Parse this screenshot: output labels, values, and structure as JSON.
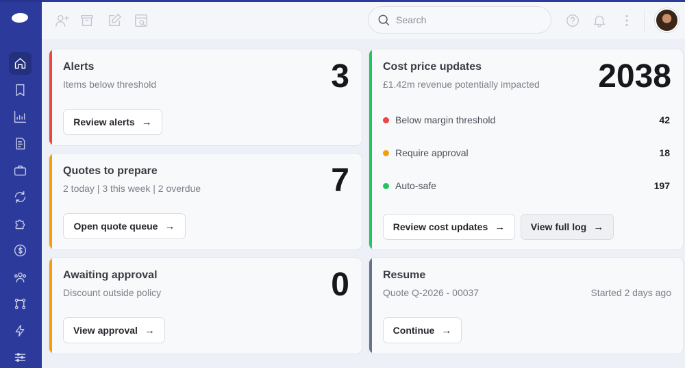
{
  "header": {
    "search_placeholder": "Search"
  },
  "sidebar": {
    "items": [
      {
        "name": "home-icon",
        "active": true
      },
      {
        "name": "bookmark-icon"
      },
      {
        "name": "chart-icon"
      },
      {
        "name": "invoice-icon"
      },
      {
        "name": "briefcase-icon"
      },
      {
        "name": "sync-icon"
      },
      {
        "name": "puzzle-icon"
      },
      {
        "name": "dollar-icon"
      },
      {
        "name": "users-icon"
      },
      {
        "name": "workflow-icon"
      },
      {
        "name": "lightning-icon"
      },
      {
        "name": "sliders-icon"
      }
    ]
  },
  "cards": {
    "alerts": {
      "title": "Alerts",
      "subtitle": "Items below threshold",
      "count": "3",
      "button": "Review alerts",
      "accent": "#ef4444"
    },
    "quotes": {
      "title": "Quotes to prepare",
      "subtitle": "2 today | 3 this week | 2 overdue",
      "count": "7",
      "button": "Open quote queue",
      "accent": "#f59e0b"
    },
    "approval": {
      "title": "Awaiting approval",
      "subtitle": "Discount outside policy",
      "count": "0",
      "button": "View approval",
      "accent": "#f59e0b"
    },
    "cost": {
      "title": "Cost price updates",
      "subtitle": "£1.42m revenue potentially impacted",
      "count": "2038",
      "accent": "#22c55e",
      "rows": [
        {
          "label": "Below margin threshold",
          "count": "42",
          "color": "#ef4444"
        },
        {
          "label": "Require approval",
          "count": "18",
          "color": "#f59e0b"
        },
        {
          "label": "Auto-safe",
          "count": "197",
          "color": "#22c55e"
        }
      ],
      "primary_button": "Review cost updates",
      "secondary_button": "View full log"
    },
    "resume": {
      "title": "Resume",
      "subtitle": "Quote Q-2026 - 00037",
      "started": "Started 2 days ago",
      "button": "Continue",
      "accent": "#64748b"
    }
  },
  "colors": {
    "sidebar": "#2c3a9c",
    "background": "#eef0f7"
  }
}
